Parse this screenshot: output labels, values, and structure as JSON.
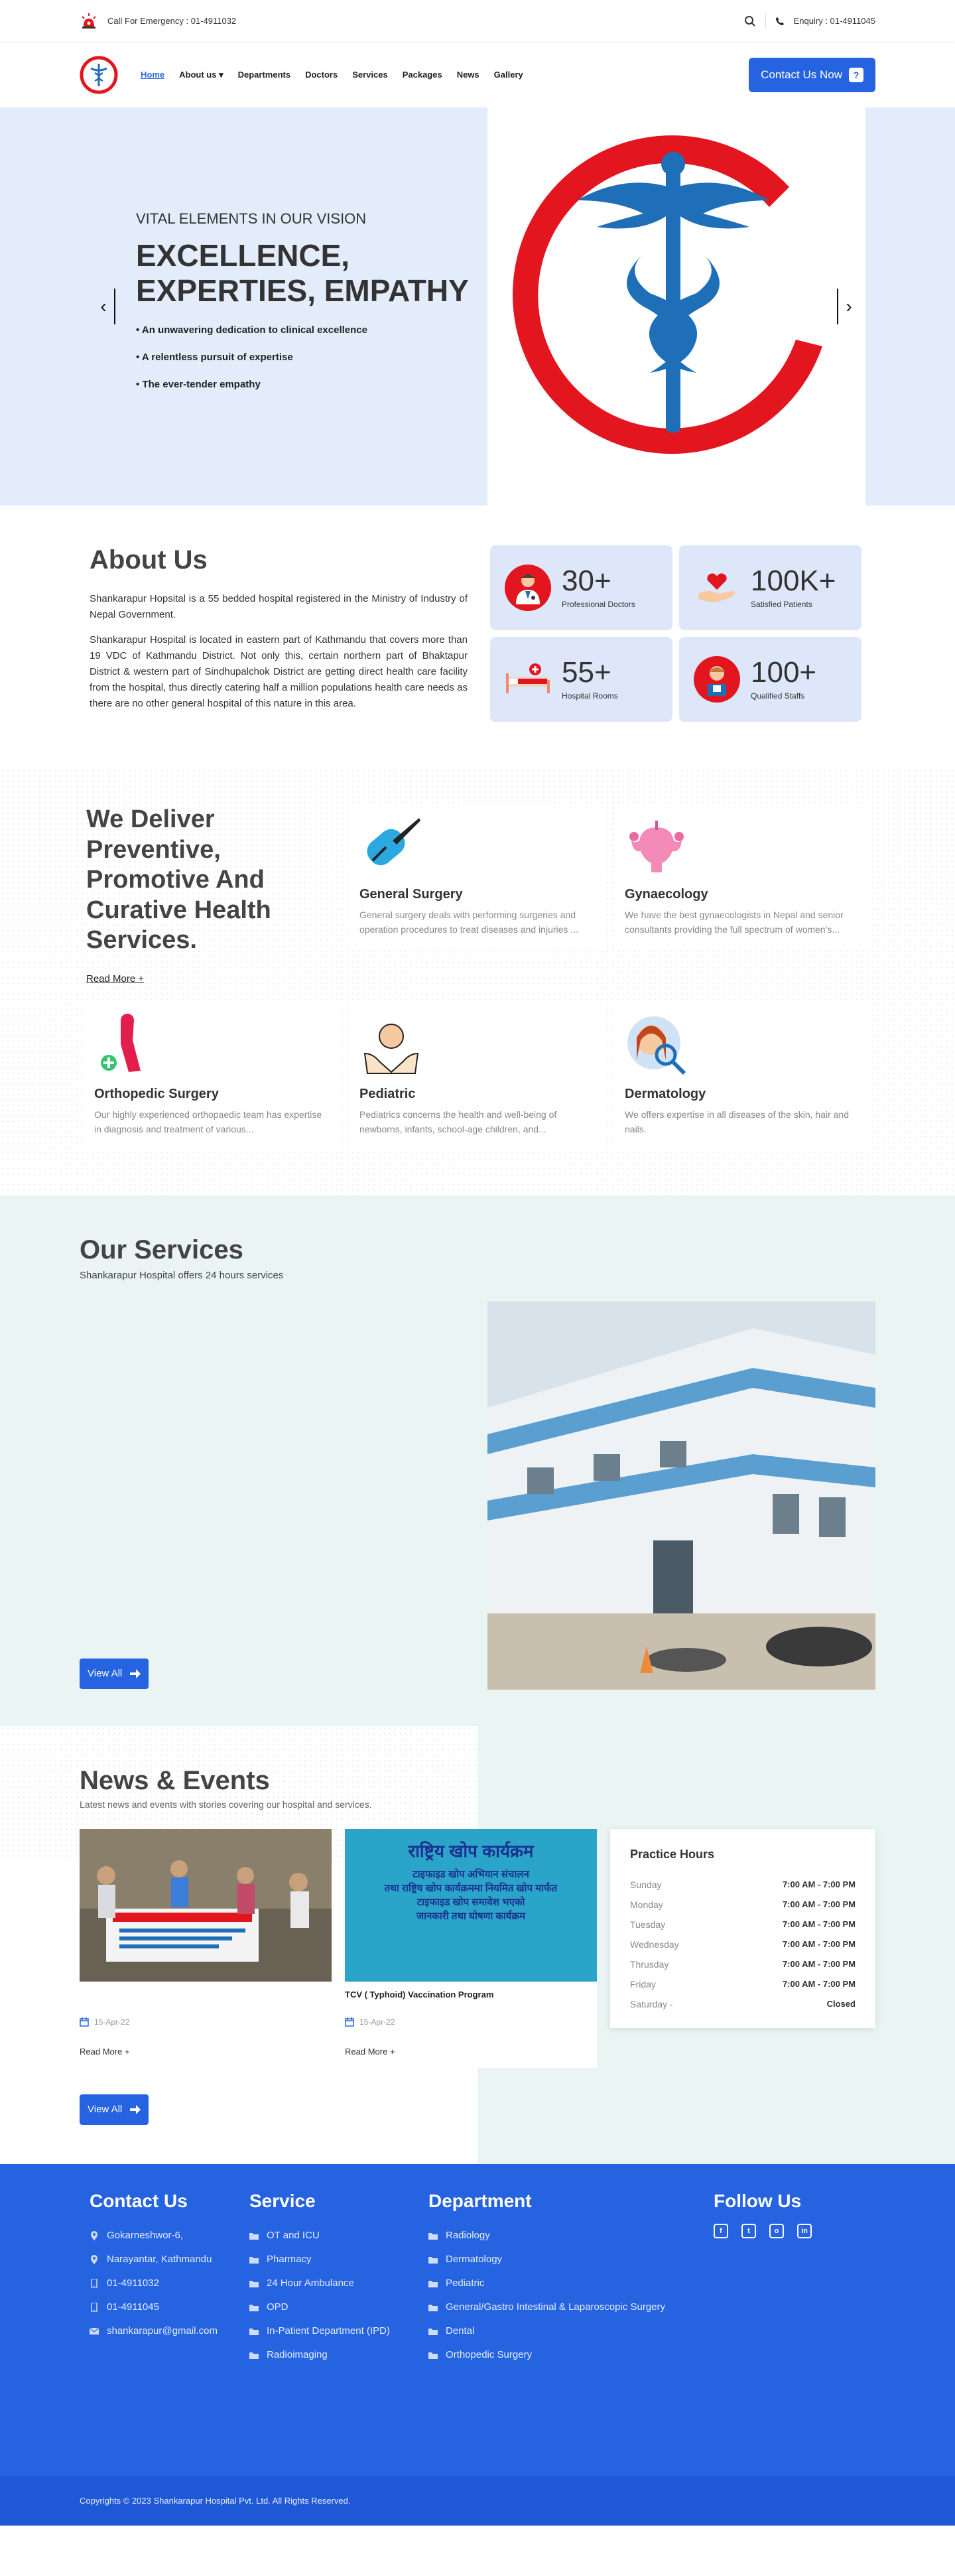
{
  "topbar": {
    "emergency": "Call For Emergency : 01-4911032",
    "enquiry": "Enquiry : 01-4911045"
  },
  "nav": {
    "items": [
      "Home",
      "About us",
      "Departments",
      "Doctors",
      "Services",
      "Packages",
      "News",
      "Gallery"
    ],
    "about_caret": "▾",
    "contact": "Contact Us Now",
    "contact_badge": "?"
  },
  "hero": {
    "subtitle": "VITAL ELEMENTS IN OUR VISION",
    "title_line1": "EXCELLENCE,",
    "title_line2": "EXPERTIES, EMPATHY",
    "bullets": [
      "• An unwavering dedication to clinical excellence",
      "• A relentless pursuit of expertise",
      "• The ever-tender empathy"
    ],
    "prev": "‹",
    "next": "›"
  },
  "about": {
    "heading": "About Us",
    "p1": "Shankarapur Hopsital is a 55 bedded hospital registered in the Ministry of Industry of Nepal Government.",
    "p2": "Shankarapur Hospital is located in eastern part of Kathmandu that covers more than 19 VDC of Kathmandu District. Not only this, certain northern part of Bhaktapur District & western part of Sindhupalchok District are getting direct health care facility from the hospital, thus directly catering half a million populations health care needs as there are no other general hospital of this nature in this area.",
    "stats": [
      {
        "num": "30+",
        "label": "Professional Doctors"
      },
      {
        "num": "100K+",
        "label": "Satisfied Patients"
      },
      {
        "num": "55+",
        "label": "Hospital Rooms"
      },
      {
        "num": "100+",
        "label": "Qualified Staffs"
      }
    ]
  },
  "health": {
    "heading": "We Deliver Preventive, Promotive And Curative Health Services.",
    "read_more": "Read More +",
    "cards": [
      {
        "title": "General Surgery",
        "desc": "General surgery deals with performing surgeries and operation procedures to treat diseases and injuries ..."
      },
      {
        "title": "Gynaecology",
        "desc": "We have the best gynaecologists in Nepal and senior consultants providing the full spectrum of women's..."
      },
      {
        "title": "Orthopedic Surgery",
        "desc": "Our highly experienced orthopaedic team has expertise in diagnosis and treatment of various..."
      },
      {
        "title": "Pediatric",
        "desc": " Pediatrics concerns the health and well-being of newborns, infants, school-age children, and..."
      },
      {
        "title": "Dermatology",
        "desc": "We  offers expertise in all diseases of the skin, hair and nails."
      }
    ]
  },
  "our_services": {
    "heading": "Our Services",
    "subtitle": "Shankarapur Hospital offers 24 hours services",
    "view_all": "View All"
  },
  "news": {
    "heading": "News & Events",
    "subtitle": "Latest news and events with stories covering our hospital and services.",
    "items": [
      {
        "title": "",
        "date": "15-Apr-22",
        "read_more": "Read More +"
      },
      {
        "title": "TCV ( Typhoid) Vaccination Program",
        "date": "15-Apr-22",
        "read_more": "Read More +"
      }
    ],
    "banner2_lines": [
      "राष्ट्रिय खोप कार्यक्रम",
      "टाइफाइड खोप अभियान संचालन",
      "तथा राष्ट्रिय खोप कार्यक्रममा नियमित खोप मार्फत",
      "टाइफाइड खोप समावेश भएको",
      "जानकारी तथा घोषणा कार्यक्रम"
    ],
    "view_all": "View All"
  },
  "hours": {
    "title": "Practice Hours",
    "rows": [
      {
        "day": "Sunday",
        "time": "7:00 AM - 7:00 PM"
      },
      {
        "day": "Monday",
        "time": "7:00 AM - 7:00 PM"
      },
      {
        "day": "Tuesday",
        "time": "7:00 AM - 7:00 PM"
      },
      {
        "day": "Wednesday",
        "time": "7:00 AM - 7:00 PM"
      },
      {
        "day": "Thrusday",
        "time": "7:00 AM - 7:00 PM"
      },
      {
        "day": "Friday",
        "time": "7:00 AM - 7:00 PM"
      },
      {
        "day": "Saturday -",
        "time": "Closed"
      }
    ]
  },
  "footer": {
    "contact": {
      "title": "Contact Us",
      "items": [
        "Gokarneshwor-6,",
        "Narayantar, Kathmandu",
        "01-4911032",
        "01-4911045",
        "shankarapur@gmail.com"
      ]
    },
    "service": {
      "title": "Service",
      "items": [
        "OT and ICU",
        "Pharmacy",
        "24 Hour Ambulance",
        "OPD",
        "In-Patient Department (IPD)",
        "Radioimaging"
      ]
    },
    "department": {
      "title": "Department",
      "items": [
        "Radiology",
        "Dermatology",
        "Pediatric",
        "General/Gastro Intestinal & Laparoscopic Surgery",
        "Dental",
        "Orthopedic Surgery"
      ]
    },
    "follow": {
      "title": "Follow Us",
      "icons": [
        "f",
        "t",
        "o",
        "in"
      ]
    },
    "copyright": "Copyrights © 2023 Shankarapur Hospital Pvt. Ltd. All Rights Reserved."
  },
  "colors": {
    "brand": "#2563e0",
    "accent_red": "#e3151f",
    "light_blue": "#e2ecfb",
    "mint": "#e9f4f3"
  }
}
